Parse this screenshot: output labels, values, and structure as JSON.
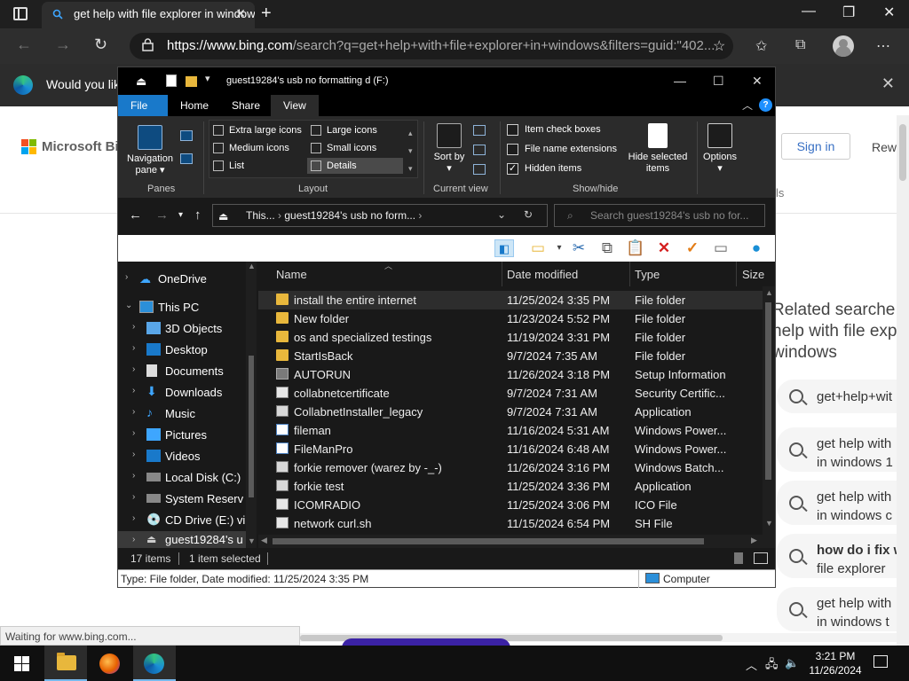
{
  "browser": {
    "tab_title": "get help with file explorer in windows",
    "url_host": "https://www.bing.com",
    "url_rest": "/search?q=get+help+with+file+explorer+in+windows&filters=guid:\"402...",
    "infobar_text": "Would you lik",
    "status_text": "Waiting for www.bing.com..."
  },
  "bing": {
    "logo_text": "Microsoft Bing",
    "signin": "Sign in",
    "rewards": "Rew",
    "tools_fragment": "ls",
    "related_heading_lines": [
      "Related searche",
      "help with file exp",
      "windows"
    ],
    "related": [
      {
        "line1": "get+help+wit",
        "line2": ""
      },
      {
        "line1": "get help with",
        "line2": "in windows 1"
      },
      {
        "line1": "get help with",
        "line2": "in windows c"
      },
      {
        "line1": "how do i fix w",
        "line2": "file explorer"
      },
      {
        "line1": "get help with",
        "line2": "in windows t"
      }
    ]
  },
  "explorer": {
    "title": "guest19284's usb no formatting d (F:)",
    "menu": {
      "file": "File",
      "home": "Home",
      "share": "Share",
      "view": "View"
    },
    "ribbon": {
      "nav_pane": "Navigation pane",
      "panes_label": "Panes",
      "layout_label": "Layout",
      "layout_options": [
        "Extra large icons",
        "Large icons",
        "Medium icons",
        "Small icons",
        "List",
        "Details"
      ],
      "sort_by": "Sort by",
      "current_view_label": "Current view",
      "checks": [
        {
          "label": "Item check boxes",
          "checked": false
        },
        {
          "label": "File name extensions",
          "checked": false
        },
        {
          "label": "Hidden items",
          "checked": true
        }
      ],
      "hide_selected": "Hide selected items",
      "show_hide_label": "Show/hide",
      "options": "Options"
    },
    "address": {
      "crumb1": "This...",
      "crumb2": "guest19284's usb no form..."
    },
    "search_placeholder": "Search guest19284's usb no for...",
    "nav_items": [
      {
        "label": "OneDrive",
        "icon": "cloud-icon"
      },
      {
        "label": "This PC",
        "icon": "computer-icon"
      },
      {
        "label": "3D Objects",
        "icon": "cube-icon"
      },
      {
        "label": "Desktop",
        "icon": "desktop-icon"
      },
      {
        "label": "Documents",
        "icon": "document-icon"
      },
      {
        "label": "Downloads",
        "icon": "download-icon"
      },
      {
        "label": "Music",
        "icon": "music-icon"
      },
      {
        "label": "Pictures",
        "icon": "picture-icon"
      },
      {
        "label": "Videos",
        "icon": "video-icon"
      },
      {
        "label": "Local Disk (C:)",
        "icon": "drive-icon"
      },
      {
        "label": "System Reserv",
        "icon": "drive-icon"
      },
      {
        "label": "CD Drive (E:) vi",
        "icon": "cd-drive-icon"
      },
      {
        "label": "guest19284's u",
        "icon": "usb-drive-icon"
      }
    ],
    "columns": [
      "Name",
      "Date modified",
      "Type",
      "Size"
    ],
    "files": [
      {
        "name": "install the entire internet",
        "date": "11/25/2024 3:35 PM",
        "type": "File folder",
        "icon": "folder"
      },
      {
        "name": "New folder",
        "date": "11/23/2024 5:52 PM",
        "type": "File folder",
        "icon": "folder"
      },
      {
        "name": "os and specialized testings",
        "date": "11/19/2024 3:31 PM",
        "type": "File folder",
        "icon": "folder"
      },
      {
        "name": "StartIsBack",
        "date": "9/7/2024 7:35 AM",
        "type": "File folder",
        "icon": "folder"
      },
      {
        "name": "AUTORUN",
        "date": "11/26/2024 3:18 PM",
        "type": "Setup Information",
        "icon": "setup"
      },
      {
        "name": "collabnetcertificate",
        "date": "9/7/2024 7:31 AM",
        "type": "Security Certific...",
        "icon": "file"
      },
      {
        "name": "CollabnetInstaller_legacy",
        "date": "9/7/2024 7:31 AM",
        "type": "Application",
        "icon": "app"
      },
      {
        "name": "fileman",
        "date": "11/16/2024 5:31 AM",
        "type": "Windows Power...",
        "icon": "ps"
      },
      {
        "name": "FileManPro",
        "date": "11/16/2024 6:48 AM",
        "type": "Windows Power...",
        "icon": "ps"
      },
      {
        "name": "forkie remover  (warez by -_-)",
        "date": "11/26/2024 3:16 PM",
        "type": "Windows Batch...",
        "icon": "app"
      },
      {
        "name": "forkie test",
        "date": "11/25/2024 3:36 PM",
        "type": "Application",
        "icon": "app"
      },
      {
        "name": "ICOMRADIO",
        "date": "11/25/2024 3:06 PM",
        "type": "ICO File",
        "icon": "file"
      },
      {
        "name": "network curl.sh",
        "date": "11/15/2024 6:54 PM",
        "type": "SH File",
        "icon": "file"
      }
    ],
    "status_items": "17 items",
    "status_selected": "1 item selected",
    "details_text": "Type: File folder, Date modified: 11/25/2024 3:35 PM",
    "details_location": "Computer"
  },
  "taskbar": {
    "time": "3:21 PM",
    "date": "11/26/2024"
  }
}
